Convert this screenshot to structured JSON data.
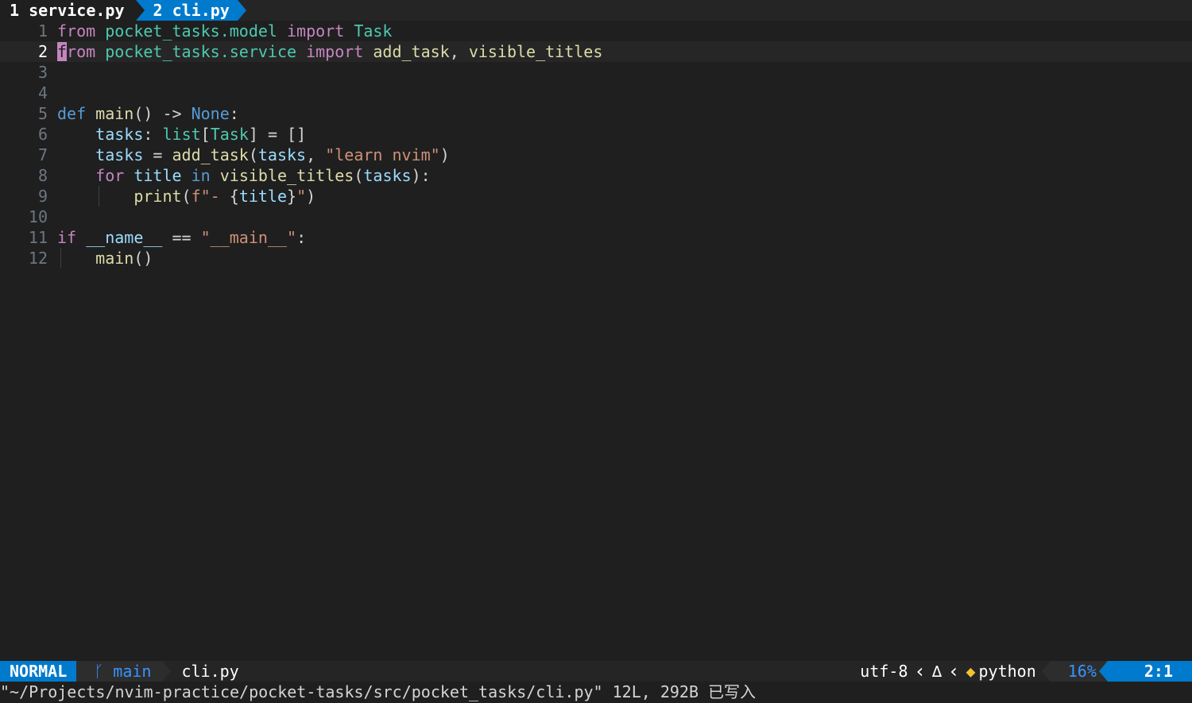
{
  "tabline": {
    "tabs": [
      {
        "label": "1 service.py",
        "active": false
      },
      {
        "label": "2 cli.py",
        "active": true
      }
    ]
  },
  "editor": {
    "current_line": 2,
    "lines": [
      {
        "num": "1",
        "tokens": [
          [
            "kw",
            "from"
          ],
          [
            "pl",
            " "
          ],
          [
            "mod",
            "pocket_tasks.model"
          ],
          [
            "pl",
            " "
          ],
          [
            "kw",
            "import"
          ],
          [
            "pl",
            " "
          ],
          [
            "mod",
            "Task"
          ]
        ]
      },
      {
        "num": "2",
        "tokens": [
          [
            "cursor",
            "f"
          ],
          [
            "kw",
            "rom"
          ],
          [
            "pl",
            " "
          ],
          [
            "mod",
            "pocket_tasks.service"
          ],
          [
            "pl",
            " "
          ],
          [
            "kw",
            "import"
          ],
          [
            "pl",
            " "
          ],
          [
            "fn",
            "add_task"
          ],
          [
            "pl",
            ", "
          ],
          [
            "fn",
            "visible_titles"
          ]
        ]
      },
      {
        "num": "3",
        "tokens": []
      },
      {
        "num": "4",
        "tokens": []
      },
      {
        "num": "5",
        "tokens": [
          [
            "kwb",
            "def"
          ],
          [
            "pl",
            " "
          ],
          [
            "fn",
            "main"
          ],
          [
            "pl",
            "() -> "
          ],
          [
            "kwb",
            "None"
          ],
          [
            "pl",
            ":"
          ]
        ]
      },
      {
        "num": "6",
        "tokens": [
          [
            "pl",
            "    "
          ],
          [
            "var",
            "tasks"
          ],
          [
            "pl",
            ": "
          ],
          [
            "mod",
            "list"
          ],
          [
            "pl",
            "["
          ],
          [
            "mod",
            "Task"
          ],
          [
            "pl",
            "] = []"
          ]
        ]
      },
      {
        "num": "7",
        "tokens": [
          [
            "pl",
            "    "
          ],
          [
            "var",
            "tasks"
          ],
          [
            "pl",
            " = "
          ],
          [
            "fn",
            "add_task"
          ],
          [
            "pl",
            "("
          ],
          [
            "var",
            "tasks"
          ],
          [
            "pl",
            ", "
          ],
          [
            "str",
            "\"learn nvim\""
          ],
          [
            "pl",
            ")"
          ]
        ]
      },
      {
        "num": "8",
        "tokens": [
          [
            "pl",
            "    "
          ],
          [
            "kw",
            "for"
          ],
          [
            "pl",
            " "
          ],
          [
            "var",
            "title"
          ],
          [
            "pl",
            " "
          ],
          [
            "kwb",
            "in"
          ],
          [
            "pl",
            " "
          ],
          [
            "fn",
            "visible_titles"
          ],
          [
            "pl",
            "("
          ],
          [
            "var",
            "tasks"
          ],
          [
            "pl",
            "):"
          ]
        ]
      },
      {
        "num": "9",
        "tokens": [
          [
            "pl",
            "        "
          ],
          [
            "fn",
            "print"
          ],
          [
            "pl",
            "("
          ],
          [
            "str",
            "f\"- "
          ],
          [
            "pl",
            "{"
          ],
          [
            "var",
            "title"
          ],
          [
            "pl",
            "}"
          ],
          [
            "str",
            "\""
          ],
          [
            "pl",
            ")"
          ]
        ]
      },
      {
        "num": "10",
        "tokens": []
      },
      {
        "num": "11",
        "tokens": [
          [
            "kw",
            "if"
          ],
          [
            "pl",
            " "
          ],
          [
            "var",
            "__name__"
          ],
          [
            "pl",
            " == "
          ],
          [
            "str",
            "\"__main__\""
          ],
          [
            "pl",
            ":"
          ]
        ]
      },
      {
        "num": "12",
        "tokens": [
          [
            "pl",
            "    "
          ],
          [
            "fn",
            "main"
          ],
          [
            "pl",
            "()"
          ]
        ]
      }
    ]
  },
  "statusline": {
    "mode": "NORMAL",
    "branch_icon": "git-branch-icon",
    "branch": "main",
    "filename": "cli.py",
    "encoding": "utf-8",
    "os_icon": "linux-tux-icon",
    "filetype_icon": "python-icon",
    "filetype": "python",
    "percent": "16%",
    "position": "2:1"
  },
  "cmdline": {
    "message": "\"~/Projects/nvim-practice/pocket-tasks/src/pocket_tasks/cli.py\" 12L, 292B 已写入"
  },
  "colors": {
    "background": "#1f1f1f",
    "accent": "#007acc",
    "keyword": "#c586c0",
    "builtin": "#569cd6",
    "module": "#4ec9b0",
    "function": "#dcdcaa",
    "variable": "#9cdcfe",
    "string": "#ce9178"
  }
}
